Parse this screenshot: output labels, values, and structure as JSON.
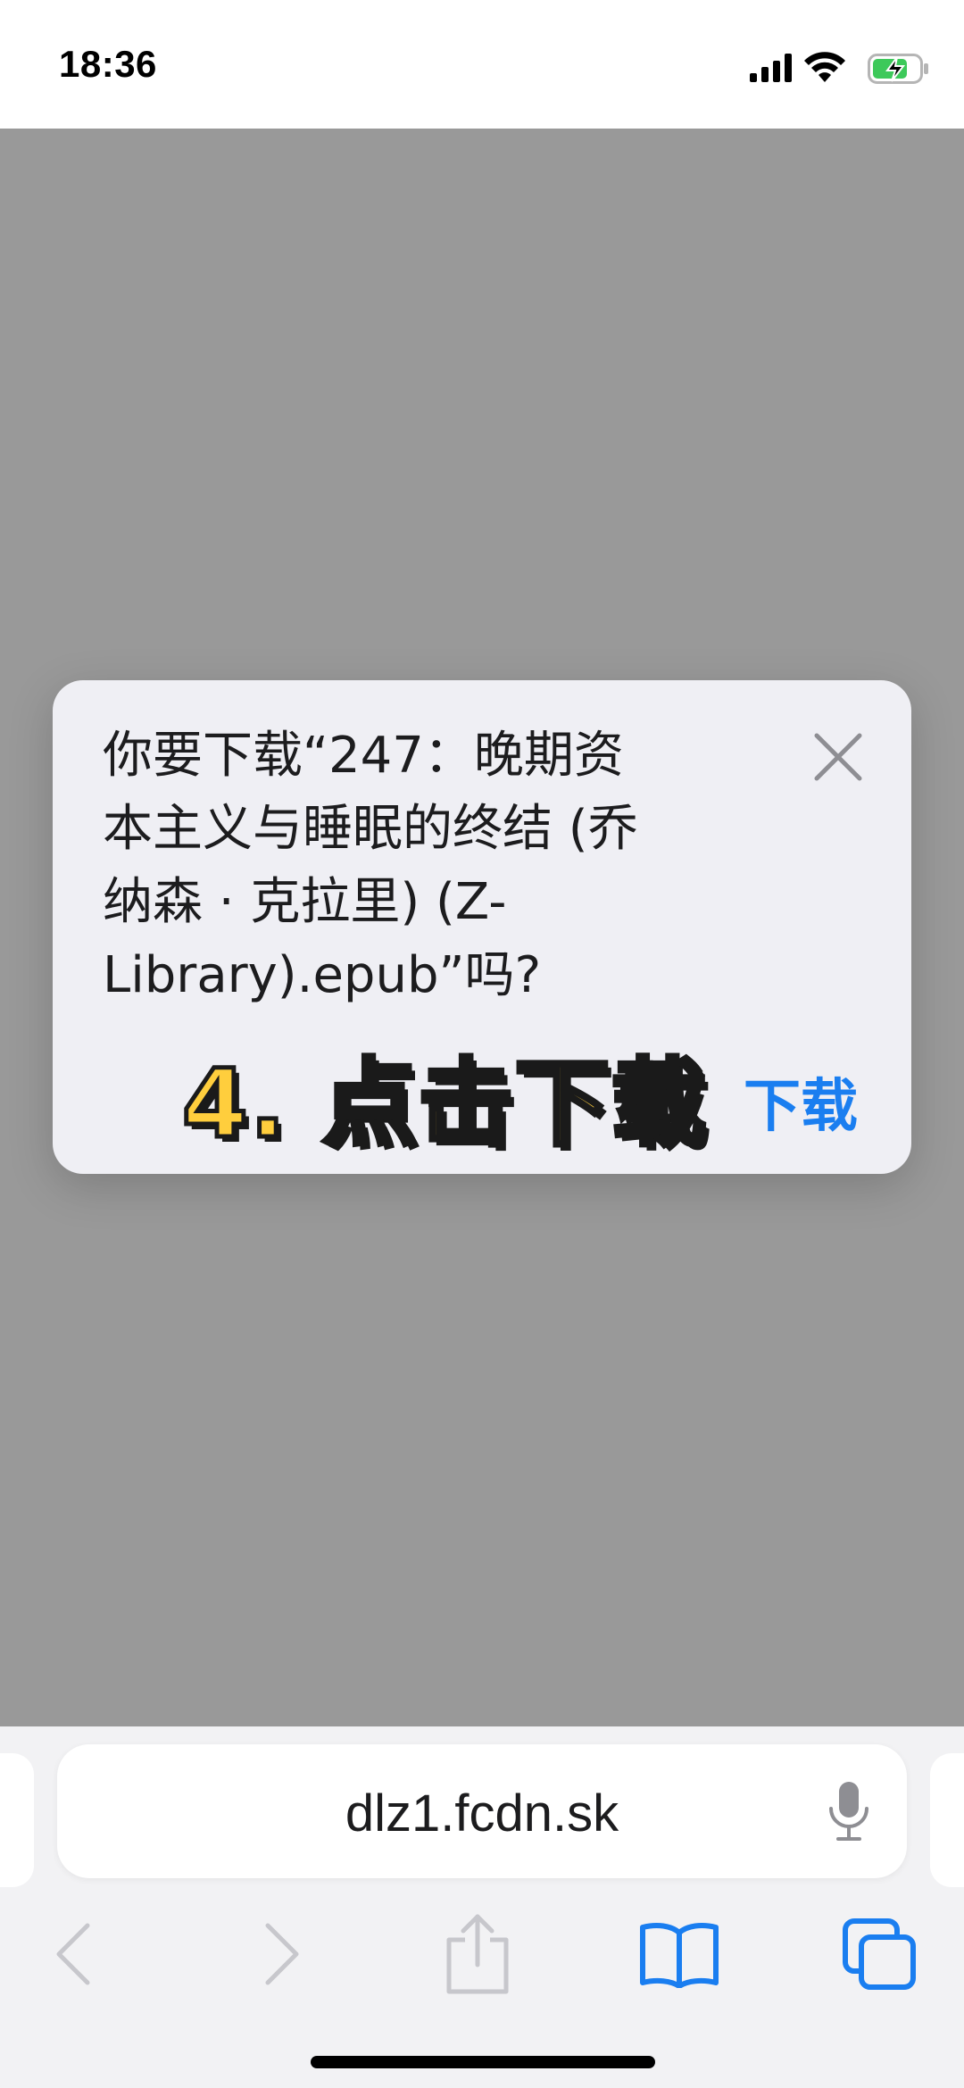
{
  "status_bar": {
    "time": "18:36",
    "icons": [
      "signal-icon",
      "wifi-icon",
      "battery-charging-icon"
    ]
  },
  "dialog": {
    "line1": "你要下载“247：晚期资",
    "line2": "本主义与睡眠的终结 (乔",
    "line3": "纳森 · 克拉里) (Z-",
    "line4": "Library).epub”吗?",
    "download_label": "下载",
    "close_icon": "close-icon"
  },
  "overlay": {
    "caption": "4. 点击下载"
  },
  "toolbar": {
    "address": "dlz1.fcdn.sk",
    "icons": [
      "microphone-icon",
      "back-icon",
      "forward-icon",
      "share-icon",
      "bookmarks-icon",
      "tabs-icon"
    ]
  },
  "colors": {
    "page_dim": "#999999",
    "dialog_bg": "#efeff4",
    "accent": "#1a7ef0",
    "caption_fill": "#ffce3d"
  }
}
